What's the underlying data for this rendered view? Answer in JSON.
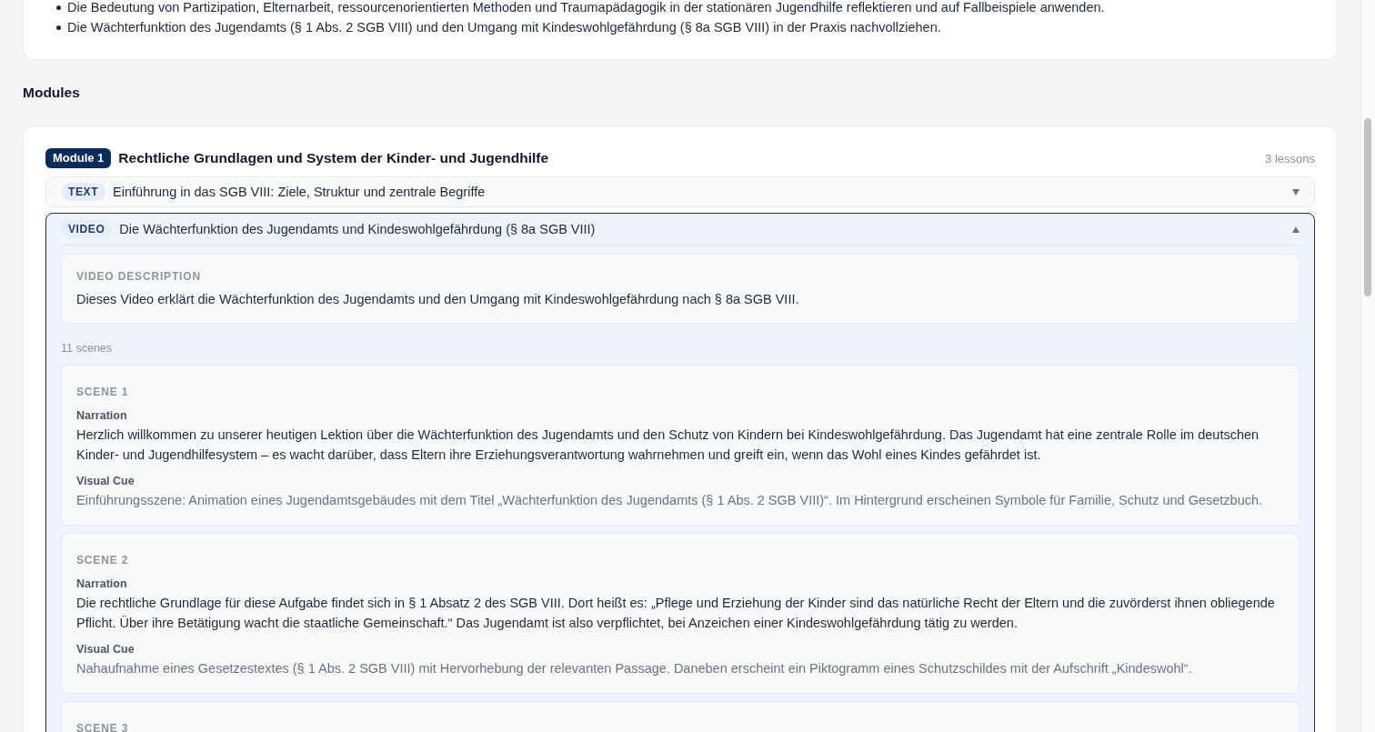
{
  "objectives_card": {
    "items": [
      "Die Bedeutung von Partizipation, Elternarbeit, ressourcenorientierten Methoden und Traumapädagogik in der stationären Jugendhilfe reflektieren und auf Fallbeispiele anwenden.",
      "Die Wächterfunktion des Jugendamts (§ 1 Abs. 2 SGB VIII) und den Umgang mit Kindeswohlgefährdung (§ 8a SGB VIII) in der Praxis nachvollziehen."
    ]
  },
  "modules_heading": "Modules",
  "modules": [
    {
      "badge": "Module 1",
      "title": "Rechtliche Grundlagen und System der Kinder- und Jugendhilfe",
      "lesson_count": "3 lessons",
      "lessons": [
        {
          "type_label": "TEXT",
          "title": "Einführung in das SGB VIII: Ziele, Struktur und zentrale Begriffe",
          "expanded": false
        },
        {
          "type_label": "VIDEO",
          "title": "Die Wächterfunktion des Jugendamts und Kindeswohlgefährdung (§ 8a SGB VIII)",
          "expanded": true,
          "description": {
            "label": "VIDEO DESCRIPTION",
            "text": "Dieses Video erklärt die Wächterfunktion des Jugendamts und den Umgang mit Kindeswohlgefährdung nach § 8a SGB VIII."
          },
          "scene_count": "11 scenes",
          "scenes": [
            {
              "label": "SCENE 1",
              "narration_label": "Narration",
              "narration": "Herzlich willkommen zu unserer heutigen Lektion über die Wächterfunktion des Jugendamts und den Schutz von Kindern bei Kindeswohlgefährdung. Das Jugendamt hat eine zentrale Rolle im deutschen Kinder- und Jugendhilfesystem – es wacht darüber, dass Eltern ihre Erziehungsverantwortung wahrnehmen und greift ein, wenn das Wohl eines Kindes gefährdet ist.",
              "visual_cue_label": "Visual Cue",
              "visual_cue": "Einführungsszene: Animation eines Jugendamtsgebäudes mit dem Titel „Wächterfunktion des Jugendamts (§ 1 Abs. 2 SGB VIII)“. Im Hintergrund erscheinen Symbole für Familie, Schutz und Gesetzbuch."
            },
            {
              "label": "SCENE 2",
              "narration_label": "Narration",
              "narration": "Die rechtliche Grundlage für diese Aufgabe findet sich in § 1 Absatz 2 des SGB VIII. Dort heißt es: „Pflege und Erziehung der Kinder sind das natürliche Recht der Eltern und die zuvörderst ihnen obliegende Pflicht. Über ihre Betätigung wacht die staatliche Gemeinschaft.“ Das Jugendamt ist also verpflichtet, bei Anzeichen einer Kindeswohlgefährdung tätig zu werden.",
              "visual_cue_label": "Visual Cue",
              "visual_cue": "Nahaufnahme eines Gesetzestextes (§ 1 Abs. 2 SGB VIII) mit Hervorhebung der relevanten Passage. Daneben erscheint ein Piktogramm eines Schutzschildes mit der Aufschrift „Kindeswohl“."
            },
            {
              "label": "SCENE 3"
            }
          ]
        }
      ]
    }
  ]
}
